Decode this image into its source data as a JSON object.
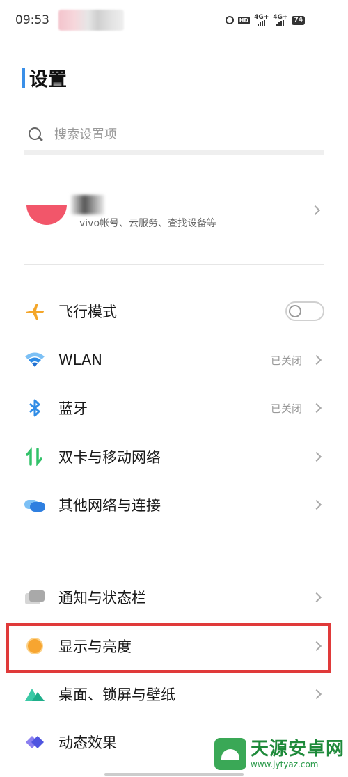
{
  "status_bar": {
    "time": "09:53",
    "hd_label": "HD",
    "net1": "4G+",
    "net2": "4G+",
    "battery": "74"
  },
  "header": {
    "title": "设置"
  },
  "search": {
    "placeholder": "搜索设置项"
  },
  "account": {
    "subtitle": "vivo帐号、云服务、查找设备等"
  },
  "settings": {
    "airplane": {
      "label": "飞行模式",
      "icon": "airplane-icon",
      "toggle_on": false
    },
    "wlan": {
      "label": "WLAN",
      "status": "已关闭",
      "icon": "wifi-icon"
    },
    "bluetooth": {
      "label": "蓝牙",
      "status": "已关闭",
      "icon": "bluetooth-icon"
    },
    "sim": {
      "label": "双卡与移动网络",
      "icon": "sim-network-icon"
    },
    "other_network": {
      "label": "其他网络与连接",
      "icon": "link-icon"
    },
    "notification": {
      "label": "通知与状态栏",
      "icon": "notification-icon"
    },
    "display": {
      "label": "显示与亮度",
      "icon": "display-icon",
      "highlighted": true
    },
    "desktop": {
      "label": "桌面、锁屏与壁纸",
      "icon": "wallpaper-icon"
    },
    "effects": {
      "label": "动态效果",
      "icon": "effects-icon"
    }
  },
  "watermark": {
    "title": "天源安卓网",
    "url": "www.jytyaz.com"
  },
  "colors": {
    "accent": "#3a8fe8",
    "avatar": "#f2566a",
    "highlight": "#e03a3a",
    "airplane": "#f4a62a",
    "wifi": "#2f8ce6",
    "sim": "#33c26a",
    "display": "#f7a530"
  }
}
